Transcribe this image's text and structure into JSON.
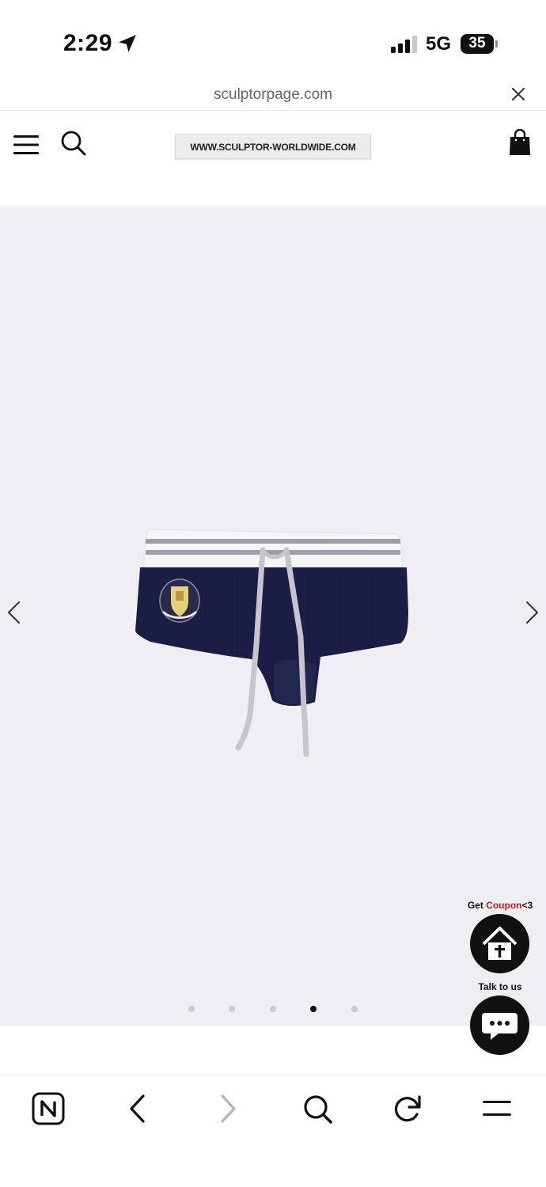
{
  "status_bar": {
    "time": "2:29",
    "network": "5G",
    "battery": "35"
  },
  "url_bar": {
    "domain": "sculptorpage.com"
  },
  "site_header": {
    "logo_text": "WWW.SCULPTOR-WORLDWIDE.COM"
  },
  "product": {
    "image_alt": "navy ribbed shorts with grey striped waistband and crest patch",
    "carousel": {
      "total": 5,
      "active_index": 3
    }
  },
  "floating": {
    "coupon_prefix": "Get ",
    "coupon_accent": "Coupon",
    "coupon_suffix": "<3",
    "talk_label": "Talk to us"
  },
  "colors": {
    "accent": "#d41a1a",
    "product_bg": "#eeeef3",
    "shorts_navy": "#1b1d45"
  },
  "icons": {
    "status": [
      "location-arrow-icon",
      "signal-icon",
      "battery-icon"
    ],
    "header": [
      "menu-icon",
      "search-icon",
      "shopping-bag-icon"
    ],
    "toolbar": [
      "naver-home-icon",
      "back-icon",
      "forward-icon",
      "search-icon",
      "refresh-icon",
      "menu-icon"
    ]
  }
}
